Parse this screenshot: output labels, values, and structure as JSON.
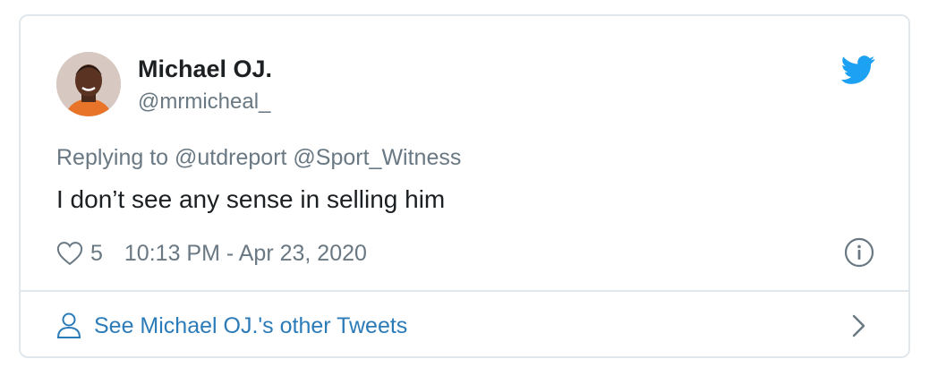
{
  "tweet": {
    "author_name": "Michael OJ.",
    "author_handle": "@mrmicheal_",
    "replying_to": "Replying to @utdreport @Sport_Witness",
    "text": "I don’t see any sense in selling him",
    "like_count": "5",
    "timestamp": "10:13 PM - Apr 23, 2020",
    "footer_link": "See Michael OJ.'s other Tweets"
  },
  "icons": {
    "brand": "twitter-bird-icon",
    "like": "heart-icon",
    "info": "info-icon",
    "profile": "person-icon",
    "chevron": "chevron-right-icon"
  },
  "colors": {
    "brand_blue": "#1da1f2",
    "link_blue": "#2b7bb9",
    "text_primary": "#1c2022",
    "text_secondary": "#697882",
    "border": "#e1e8ed"
  }
}
